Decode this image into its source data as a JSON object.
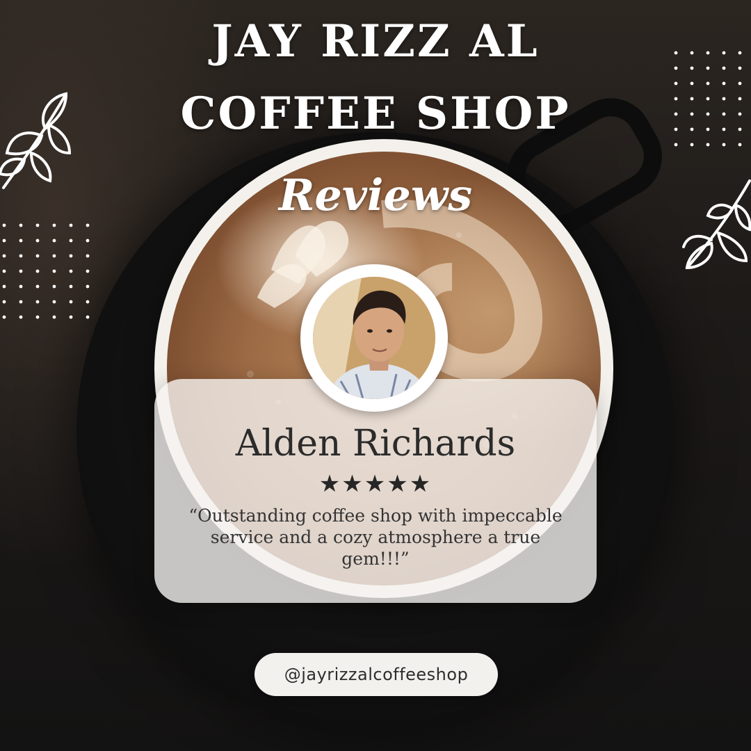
{
  "header": {
    "title_line1": "JAY RIZZ AL",
    "title_line2": "COFFEE SHOP",
    "subtitle": "Reviews"
  },
  "review": {
    "reviewer_name": "Alden Richards",
    "rating": 5,
    "rating_max": 5,
    "stars_text": "★★★★★",
    "quote": "“Outstanding coffee shop with impeccable service and a cozy atmosphere a true gem!!!”"
  },
  "footer": {
    "social_handle": "@jayrizzalcoffeeshop"
  },
  "colors": {
    "background": "#141414",
    "card": "#f5f3f0",
    "text_dark": "#2b2b2b",
    "title_text": "#ffffff"
  },
  "icons": [
    "leaf-branch-icon",
    "star-icon",
    "dot-grid-decoration"
  ]
}
